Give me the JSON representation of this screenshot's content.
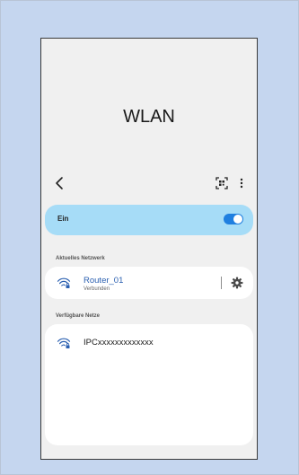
{
  "screen": {
    "title": "WLAN"
  },
  "toolbar": {
    "back_icon": "chevron-left-icon",
    "scan_icon": "qr-scan-icon",
    "more_icon": "more-vertical-icon"
  },
  "wifi_toggle": {
    "label": "Ein",
    "state": true
  },
  "current_network": {
    "header": "Aktuelles Netzwerk",
    "name": "Router_01",
    "status": "Verbunden",
    "icon": "wifi-lock-icon",
    "settings_icon": "gear-icon"
  },
  "available_networks": {
    "header": "Verfügbare Netze",
    "items": [
      {
        "name": "IPCxxxxxxxxxxxxx",
        "icon": "wifi-lock-icon"
      }
    ]
  },
  "colors": {
    "background": "#c5d6ef",
    "screen": "#f0f0f0",
    "toggle_card": "#a6dcf7",
    "accent": "#1f7fe0",
    "connected_text": "#2a5fb0"
  }
}
